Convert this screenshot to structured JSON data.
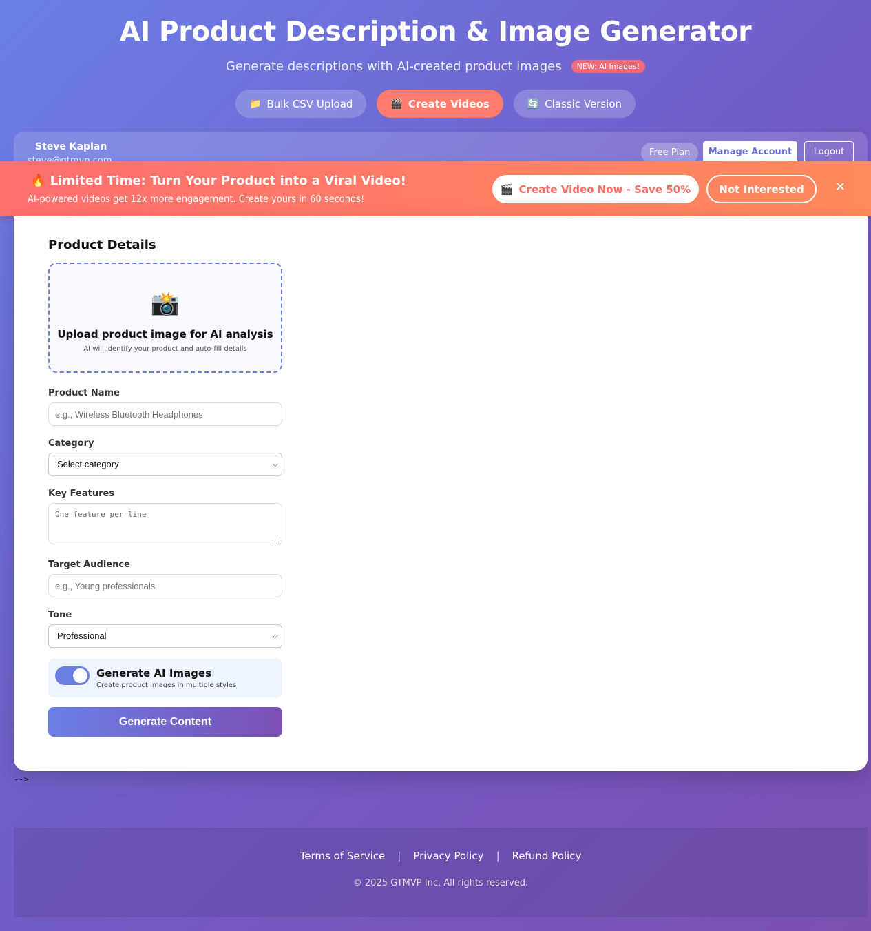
{
  "header": {
    "title": "AI Product Description & Image Generator",
    "subtitle": "Generate descriptions with AI-created product images",
    "badge": "NEW: AI Images!"
  },
  "nav": [
    {
      "icon": "📁",
      "label": "Bulk CSV Upload"
    },
    {
      "icon": "🎬",
      "label": "Create Videos"
    },
    {
      "icon": "🔄",
      "label": "Classic Version"
    }
  ],
  "user": {
    "name": "Steve Kaplan",
    "email": "steve@gtmvp.com",
    "plan": "Free Plan",
    "manage_label": "Manage Account",
    "logout_label": "Logout"
  },
  "promo": {
    "icon": "🔥",
    "title": "Limited Time: Turn Your Product into a Viral Video!",
    "subtitle": "AI-powered videos get 12x more engagement. Create yours in 60 seconds!",
    "cta_icon": "🎬",
    "cta_label": "Create Video Now - Save 50%",
    "decline_label": "Not Interested",
    "close_glyph": "✕"
  },
  "form": {
    "section_title": "Product Details",
    "upload": {
      "icon": "📸",
      "title": "Upload product image for AI analysis",
      "subtitle": "AI will identify your product and auto-fill details"
    },
    "product_name": {
      "label": "Product Name",
      "placeholder": "e.g., Wireless Bluetooth Headphones"
    },
    "category": {
      "label": "Category",
      "value": "Select category"
    },
    "features": {
      "label": "Key Features",
      "placeholder": "One feature per line"
    },
    "audience": {
      "label": "Target Audience",
      "placeholder": "e.g., Young professionals"
    },
    "tone": {
      "label": "Tone",
      "value": "Professional"
    },
    "ai_images": {
      "title": "Generate AI Images",
      "subtitle": "Create product images in multiple styles",
      "enabled": true
    },
    "generate_label": "Generate Content"
  },
  "stray_text": "-->",
  "footer": {
    "links": [
      "Terms of Service",
      "Privacy Policy",
      "Refund Policy"
    ],
    "separator": "|",
    "copyright": "© 2025 GTMVP Inc. All rights reserved."
  },
  "colors": {
    "accent": "#6a7fe0",
    "promo": "#ff6f6f",
    "cta_text": "#ff6b63",
    "badge": "#f06a7a"
  }
}
